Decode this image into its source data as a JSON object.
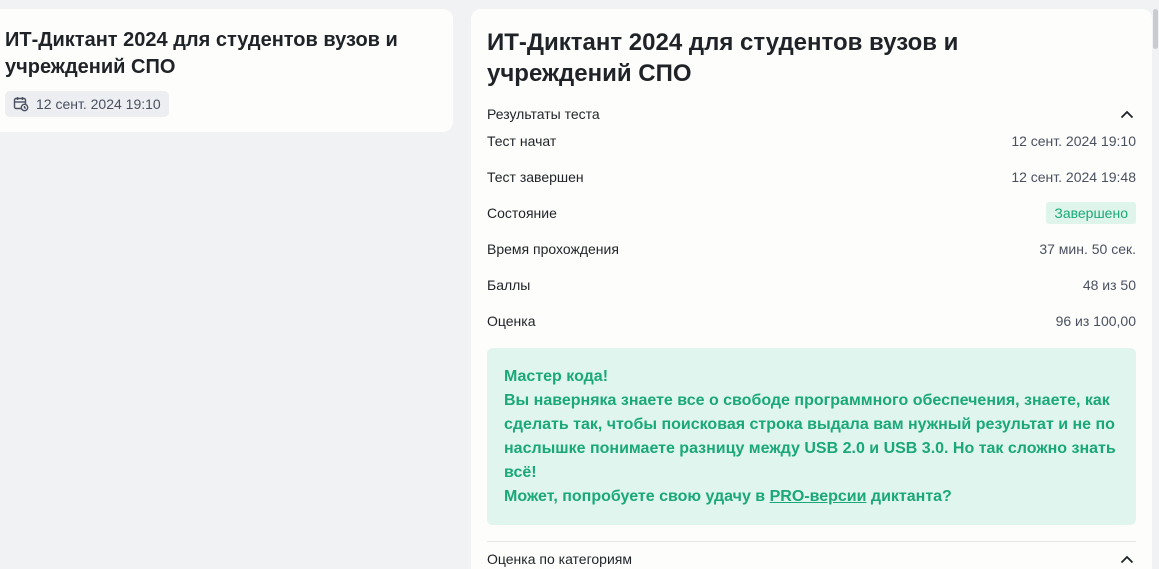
{
  "left_card": {
    "title": "ИТ-Диктант 2024 для студентов вузов и учреждений СПО",
    "date": "12 сент. 2024 19:10",
    "date_icon": "calendar-clock-icon"
  },
  "right_card": {
    "title": "ИТ-Диктант 2024 для студентов вузов и учреждений СПО",
    "results_label": "Результаты теста",
    "rows": [
      {
        "label": "Тест начат",
        "value": "12 сент. 2024 19:10"
      },
      {
        "label": "Тест завершен",
        "value": "12 сент. 2024 19:48"
      },
      {
        "label": "Состояние",
        "value": "Завершено"
      },
      {
        "label": "Время прохождения",
        "value": "37 мин. 50 сек."
      },
      {
        "label": "Баллы",
        "value": "48 из 50"
      },
      {
        "label": "Оценка",
        "value": "96 из 100,00"
      }
    ],
    "message": {
      "heading": "Мастер кода!",
      "body": "Вы наверняка знаете все о свободе программного обеспечения, знаете, как сделать так, чтобы поисковая строка выдала вам нужный результат и не по наслышке понимаете разницу между USB 2.0 и USB 3.0. Но так сложно знать всё!",
      "cta_prefix": "Может, попробуете свою удачу в ",
      "cta_link": "PRO-версии",
      "cta_suffix": " диктанта?"
    },
    "categories_label": "Оценка по категориям"
  },
  "colors": {
    "accent_green": "#1aa878",
    "badge_bg": "#dff5ec",
    "message_bg": "#e0f5ee",
    "page_bg": "#f0f2f3",
    "card_bg": "#fdfdfb"
  }
}
